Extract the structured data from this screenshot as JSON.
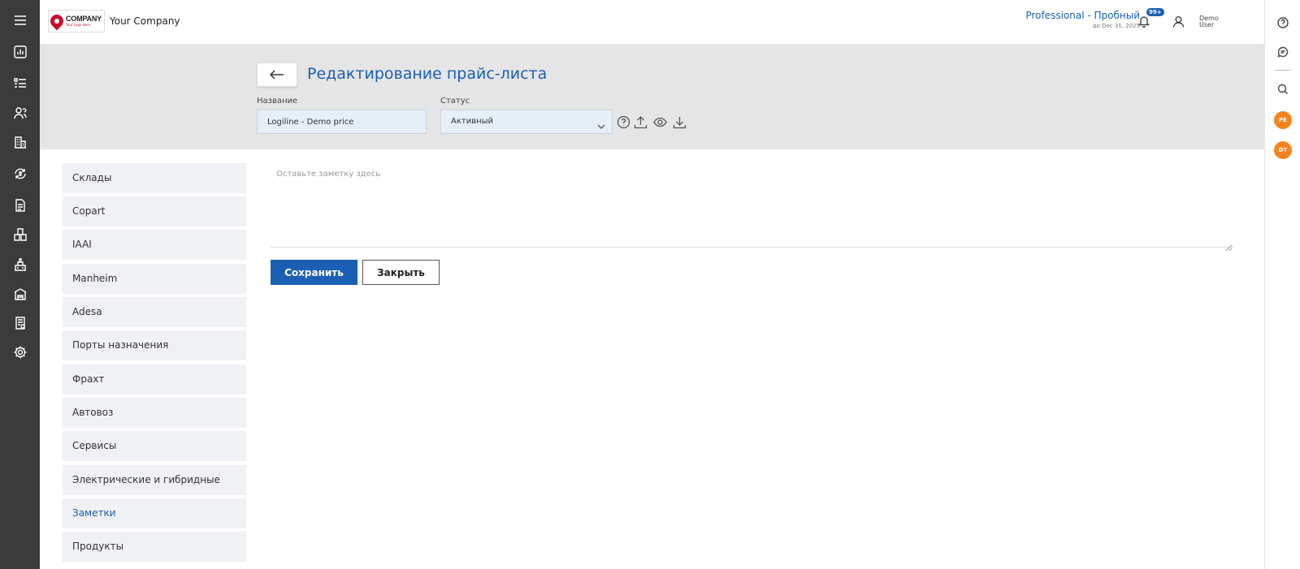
{
  "header": {
    "logo_text": "COMPANY",
    "logo_tagline": "Your Logo Here",
    "company_name": "Your Company",
    "plan_title": "Professional - Пробный",
    "plan_until": "до Dec 31, 2025",
    "notifications_badge": "99+",
    "user_name_line1": "Demo",
    "user_name_line2": "User"
  },
  "left_rail": {
    "icons": [
      "menu-icon",
      "dashboard-icon",
      "list-icon",
      "users-icon",
      "buildings-icon",
      "exchange-icon",
      "document-icon",
      "boxes-icon",
      "factory-icon",
      "warehouse-icon",
      "invoice-icon",
      "gear-icon"
    ]
  },
  "right_rail": {
    "icons": [
      "help-icon",
      "chat-icon",
      "search-icon"
    ],
    "avatars": [
      "PE",
      "DT"
    ]
  },
  "page": {
    "title": "Редактирование прайс-листа",
    "name_label": "Название",
    "name_value": "Logiline - Demo price",
    "status_label": "Статус",
    "status_value": "Активный",
    "tool_icons": [
      "help-circle-icon",
      "upload-icon",
      "eye-icon",
      "download-icon"
    ]
  },
  "side_menu": {
    "items": [
      {
        "label": "Склады"
      },
      {
        "label": "Copart"
      },
      {
        "label": "IAAI"
      },
      {
        "label": "Manheim"
      },
      {
        "label": "Adesa"
      },
      {
        "label": "Порты назначения"
      },
      {
        "label": "Фрахт"
      },
      {
        "label": "Автовоз"
      },
      {
        "label": "Сервисы"
      },
      {
        "label": "Электрические и гибридные"
      },
      {
        "label": "Заметки"
      },
      {
        "label": "Продукты"
      }
    ],
    "active_label": "Заметки"
  },
  "notes": {
    "placeholder": "Оставьте заметку здесь",
    "save_label": "Сохранить",
    "close_label": "Закрыть"
  },
  "colors": {
    "accent": "#1a5fb4",
    "sidebar_bg": "#3b3b3b",
    "avatar_bg": "#f5841f",
    "band_bg": "#e5e5e5"
  }
}
